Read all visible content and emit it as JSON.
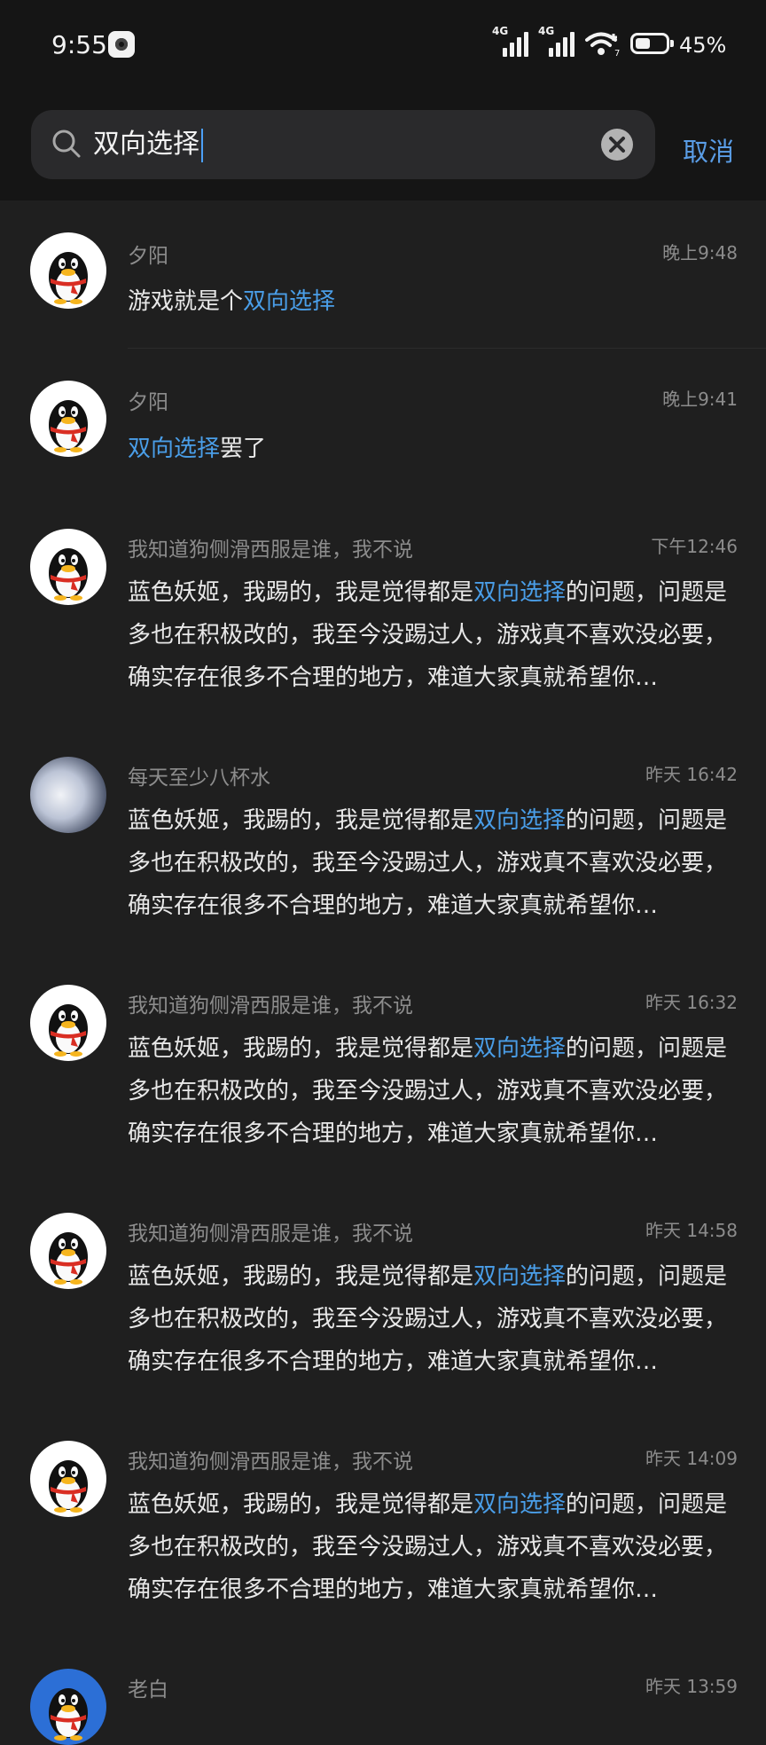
{
  "status_bar": {
    "time": "9:55",
    "signal1_tag": "4G",
    "signal2_tag": "4G",
    "wifi_suffix": "7",
    "battery": "45%"
  },
  "search": {
    "query": "双向选择",
    "cancel_label": "取消"
  },
  "results": [
    {
      "name": "夕阳",
      "time": "晚上9:48",
      "before": "游戏就是个",
      "match": "双向选择",
      "after": ""
    },
    {
      "name": "夕阳",
      "time": "晚上9:41",
      "before": "",
      "match": "双向选择",
      "after": "罢了"
    },
    {
      "name": "我知道狗侧滑西服是谁，我不说",
      "time": "下午12:46",
      "before": "蓝色妖姬，我踢的，我是觉得都是",
      "match": "双向选择",
      "after": "的问题，问题是多也在积极改的，我至今没踢过人，游戏真不喜欢没必要，确实存在很多不合理的地方，难道大家真就希望你…"
    },
    {
      "name": "每天至少八杯水",
      "time": "昨天 16:42",
      "before": "蓝色妖姬，我踢的，我是觉得都是",
      "match": "双向选择",
      "after": "的问题，问题是多也在积极改的，我至今没踢过人，游戏真不喜欢没必要，确实存在很多不合理的地方，难道大家真就希望你…"
    },
    {
      "name": "我知道狗侧滑西服是谁，我不说",
      "time": "昨天 16:32",
      "before": "蓝色妖姬，我踢的，我是觉得都是",
      "match": "双向选择",
      "after": "的问题，问题是多也在积极改的，我至今没踢过人，游戏真不喜欢没必要，确实存在很多不合理的地方，难道大家真就希望你…"
    },
    {
      "name": "我知道狗侧滑西服是谁，我不说",
      "time": "昨天 14:58",
      "before": "蓝色妖姬，我踢的，我是觉得都是",
      "match": "双向选择",
      "after": "的问题，问题是多也在积极改的，我至今没踢过人，游戏真不喜欢没必要，确实存在很多不合理的地方，难道大家真就希望你…"
    },
    {
      "name": "我知道狗侧滑西服是谁，我不说",
      "time": "昨天 14:09",
      "before": "蓝色妖姬，我踢的，我是觉得都是",
      "match": "双向选择",
      "after": "的问题，问题是多也在积极改的，我至今没踢过人，游戏真不喜欢没必要，确实存在很多不合理的地方，难道大家真就希望你…"
    },
    {
      "name": "老白",
      "time": "昨天 13:59",
      "before": "",
      "match": "",
      "after": ""
    }
  ],
  "colors": {
    "background": "#1f1f1f",
    "header": "#151515",
    "highlight": "#4a9ee8",
    "accent": "#5a9de6"
  },
  "icons": [
    "search-icon",
    "clear-icon",
    "wifi-icon",
    "battery-icon",
    "signal-icon",
    "penguin-avatar-icon"
  ]
}
